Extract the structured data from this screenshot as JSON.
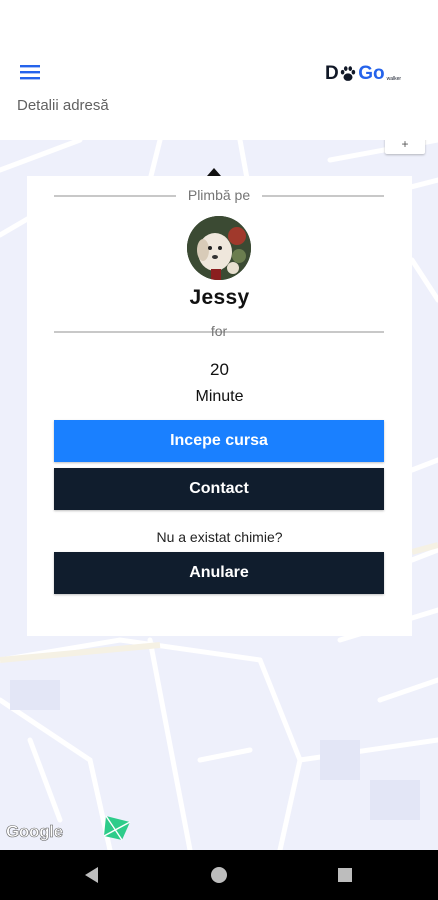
{
  "header": {
    "logo_text": "DoGo",
    "logo_small_text": "walker",
    "subtitle": "Detalii adresă"
  },
  "card": {
    "walk_by_label": "Plimbă pe",
    "dog_name": "Jessy",
    "for_label": "for",
    "duration_value": "20",
    "duration_unit": "Minute",
    "start_button_label": "Incepe cursa",
    "contact_button_label": "Contact",
    "question_text": "Nu a existat chimie?",
    "cancel_button_label": "Anulare"
  },
  "map": {
    "attribution": "Google"
  },
  "colors": {
    "primary_blue": "#1a80ff",
    "dark_navy": "#101d2d",
    "logo_blue": "#2563eb",
    "map_background": "#eef0fb"
  },
  "icons": {
    "menu": "hamburger-menu-icon",
    "back": "nav-back-icon",
    "home": "nav-home-icon",
    "recents": "nav-recents-icon"
  }
}
